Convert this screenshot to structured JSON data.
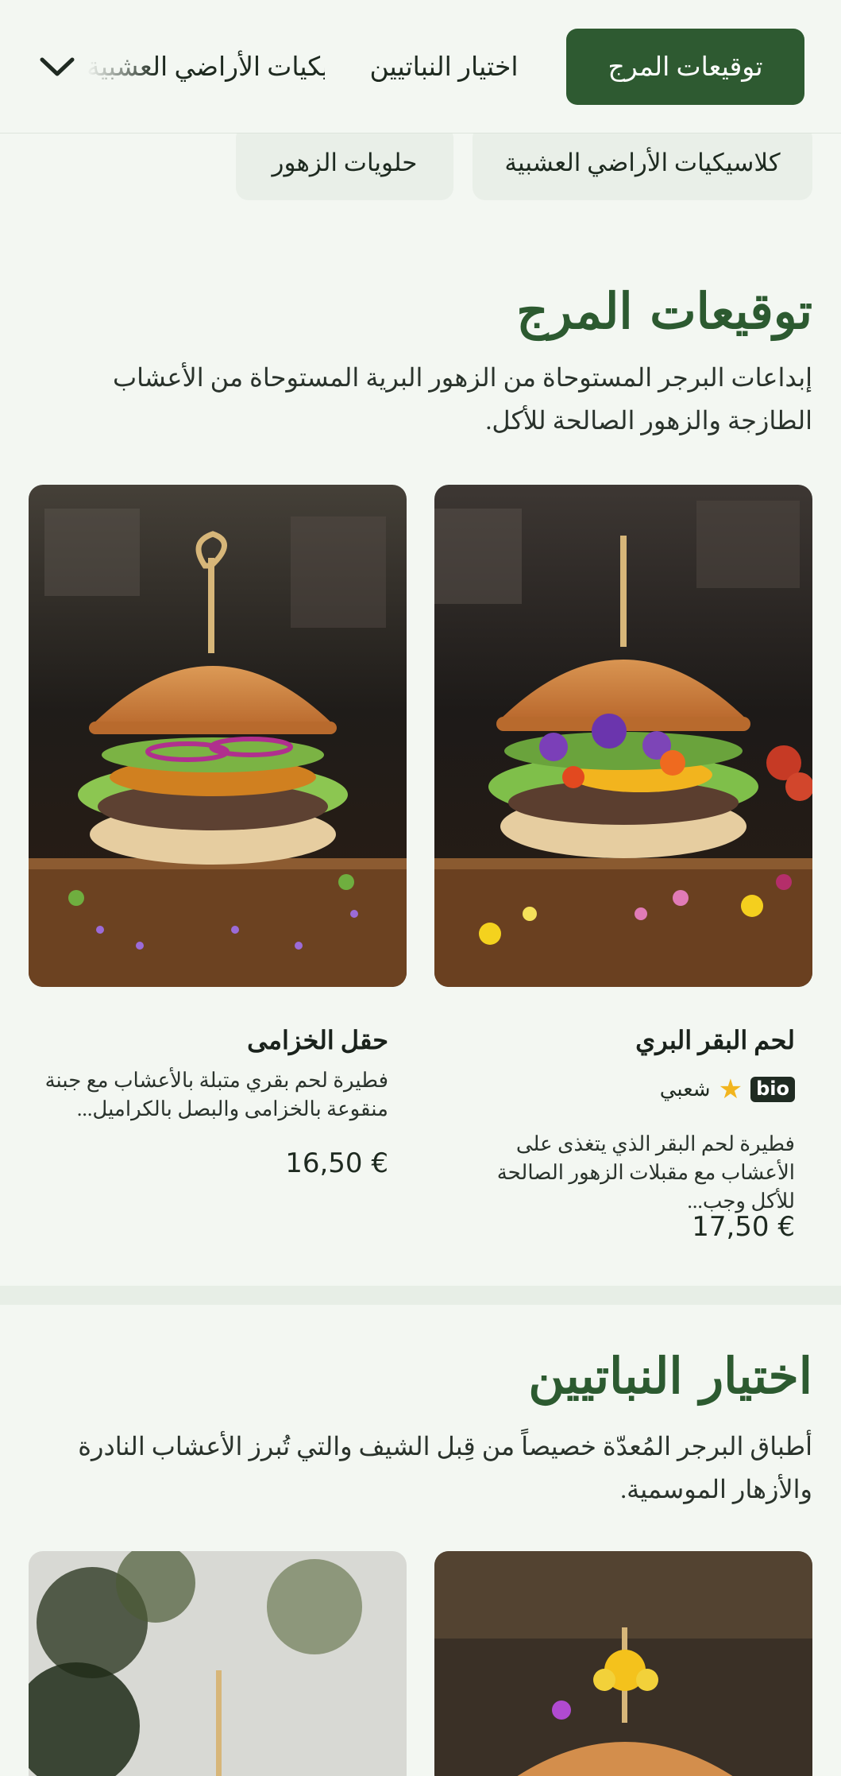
{
  "nav": {
    "tabs": [
      {
        "label": "توقيعات المرج",
        "active": true
      },
      {
        "label": "اختيار النباتيين",
        "active": false
      },
      {
        "label": "كلاسيكيات الأراضي العشبية",
        "active": false
      }
    ],
    "expand_icon": "chevron-down-icon"
  },
  "subnav": {
    "chips": [
      {
        "label": "كلاسيكيات الأراضي العشبية"
      },
      {
        "label": "حلويات الزهور"
      }
    ]
  },
  "sections": [
    {
      "title": "توقيعات المرج",
      "description": "إبداعات البرجر المستوحاة من الزهور البرية المستوحاة من الأعشاب الطازجة والزهور الصالحة للأكل.",
      "items": [
        {
          "name": "لحم البقر البري",
          "badge": "bio",
          "badge_icon": "star-icon",
          "tag": "شعبي",
          "description": "فطيرة لحم البقر الذي يتغذى على الأعشاب مع مقبلات الزهور الصالحة للأكل وجب...",
          "price": "17,50 €"
        },
        {
          "name": "حقل الخزامى",
          "description": "فطيرة لحم بقري متبلة بالأعشاب مع جبنة منقوعة بالخزامى والبصل بالكراميل...",
          "price": "16,50 €"
        }
      ]
    },
    {
      "title": "اختيار النباتيين",
      "description": "أطباق البرجر المُعدّة خصيصاً من قِبل الشيف والتي تُبرز الأعشاب النادرة والأزهار الموسمية."
    }
  ],
  "colors": {
    "brand_green": "#2e5a31",
    "background": "#f3f7f2",
    "chip_bg": "#e9efe8",
    "star": "#f2b51f"
  }
}
